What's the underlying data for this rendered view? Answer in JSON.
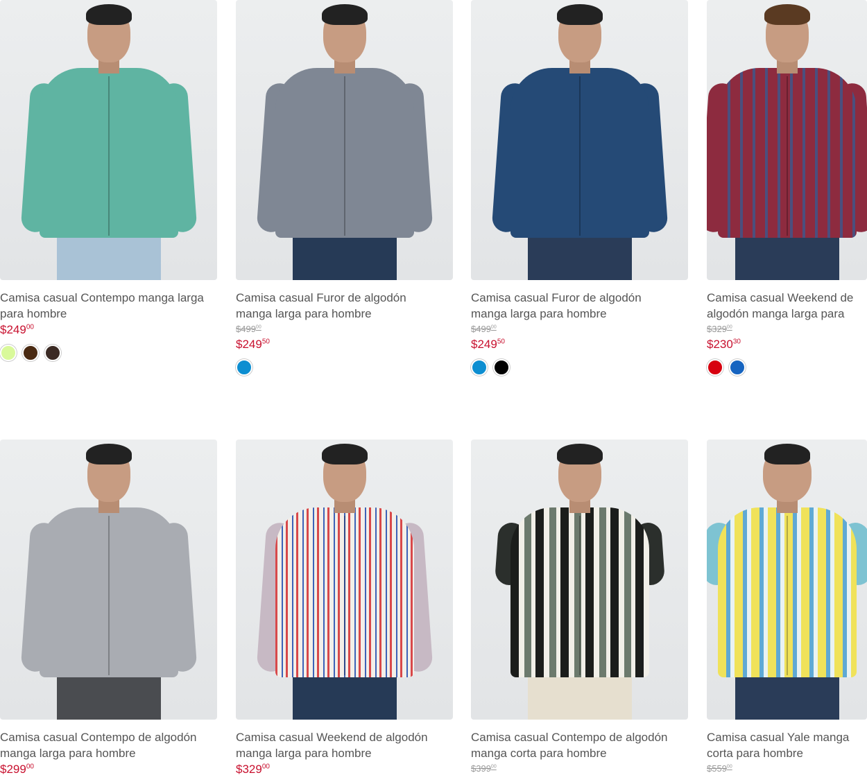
{
  "products": [
    {
      "title": "Camisa casual Contempo manga larga para hombre",
      "old_price": "",
      "old_cents": "",
      "price": "$249",
      "cents": "00",
      "swatches": [
        "#d9f99a",
        "#4a2a12",
        "#3b2a24"
      ],
      "shirt_color": "#5fb4a2",
      "pants_color": "#a9c2d6",
      "swatch_icon": "color-swatch-icon"
    },
    {
      "title": "Camisa casual Furor de algodón manga larga para hombre",
      "old_price": "$499",
      "old_cents": "00",
      "price": "$249",
      "cents": "50",
      "swatches": [
        "#0d8ed1"
      ],
      "shirt_color": "#7f8794",
      "pants_color": "#263a56",
      "swatch_icon": "color-swatch-icon"
    },
    {
      "title": "Camisa casual Furor de algodón manga larga para hombre",
      "old_price": "$499",
      "old_cents": "00",
      "price": "$249",
      "cents": "50",
      "swatches": [
        "#0d8ed1",
        "#000000"
      ],
      "shirt_color": "#254a76",
      "pants_color": "#2a3c58",
      "swatch_icon": "color-swatch-icon"
    },
    {
      "title": "Camisa casual Weekend de algodón manga larga para hombre",
      "old_price": "$329",
      "old_cents": "00",
      "price": "$230",
      "cents": "30",
      "swatches": [
        "#d7000f",
        "#1664c0"
      ],
      "shirt_color": "#8d2b3f",
      "pants_color": "#2a3c58",
      "swatch_icon": "color-swatch-icon"
    },
    {
      "title": "Camisa casual Contempo de algodón manga larga para hombre",
      "old_price": "",
      "old_cents": "",
      "price": "$299",
      "cents": "00",
      "swatches": [],
      "shirt_color": "#a9acb2",
      "pants_color": "#4a4c50",
      "swatch_icon": "color-swatch-icon"
    },
    {
      "title": "Camisa casual Weekend de algodón manga larga para hombre",
      "old_price": "",
      "old_cents": "",
      "price": "$329",
      "cents": "00",
      "swatches": [],
      "shirt_color": "#c7b9c4",
      "pants_color": "#263a56",
      "swatch_icon": "color-swatch-icon"
    },
    {
      "title": "Camisa casual Contempo de algodón manga corta para hombre",
      "old_price": "$399",
      "old_cents": "00",
      "price": "",
      "cents": "",
      "swatches": [],
      "shirt_color": "#2b2f2c",
      "pants_color": "#e6dfcf",
      "swatch_icon": "color-swatch-icon"
    },
    {
      "title": "Camisa casual Yale manga corta para hombre",
      "old_price": "$559",
      "old_cents": "00",
      "price": "",
      "cents": "",
      "swatches": [],
      "shirt_color": "#7ec3d2",
      "pants_color": "#2a3c58",
      "swatch_icon": "color-swatch-icon"
    }
  ]
}
